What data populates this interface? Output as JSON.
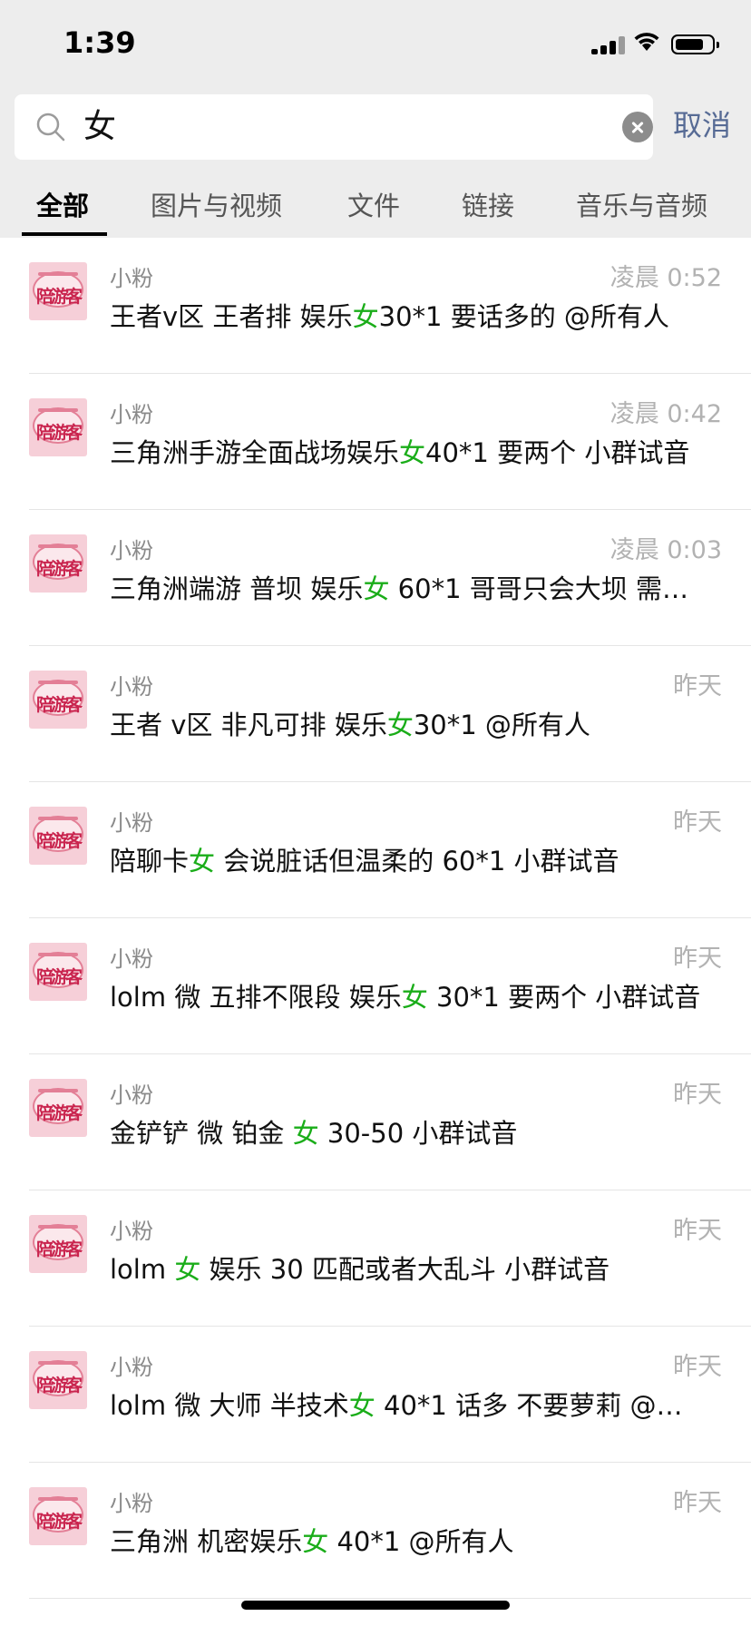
{
  "status_bar": {
    "time": "1:39",
    "battery_level": 0.8
  },
  "search": {
    "query": "女",
    "cancel_label": "取消"
  },
  "tabs": [
    {
      "label": "全部",
      "active": true
    },
    {
      "label": "图片与视频",
      "active": false
    },
    {
      "label": "文件",
      "active": false
    },
    {
      "label": "链接",
      "active": false
    },
    {
      "label": "音乐与音频",
      "active": false
    }
  ],
  "avatar_text": "陪游客",
  "highlight_color": "#1aad19",
  "results": [
    {
      "sender": "小粉",
      "time": "凌晨 0:52",
      "pre": "王者v区 王者排  娱乐",
      "hit": "女",
      "post": "30*1  要话多的  @所有人"
    },
    {
      "sender": "小粉",
      "time": "凌晨 0:42",
      "pre": "三角洲手游全面战场娱乐",
      "hit": "女",
      "post": "40*1 要两个 小群试音"
    },
    {
      "sender": "小粉",
      "time": "凌晨 0:03",
      "pre": "三角洲端游 普坝 娱乐",
      "hit": "女",
      "post": " 60*1 哥哥只会大坝 需…"
    },
    {
      "sender": "小粉",
      "time": "昨天",
      "pre": "王者  v区 非凡可排  娱乐",
      "hit": "女",
      "post": "30*1   @所有人"
    },
    {
      "sender": "小粉",
      "time": "昨天",
      "pre": "陪聊卡",
      "hit": "女",
      "post": " 会说脏话但温柔的 60*1 小群试音"
    },
    {
      "sender": "小粉",
      "time": "昨天",
      "pre": "lolm 微 五排不限段 娱乐",
      "hit": "女",
      "post": " 30*1 要两个 小群试音"
    },
    {
      "sender": "小粉",
      "time": "昨天",
      "pre": "金铲铲 微 铂金 ",
      "hit": "女",
      "post": " 30-50 小群试音"
    },
    {
      "sender": "小粉",
      "time": "昨天",
      "pre": "lolm ",
      "hit": "女",
      "post": " 娱乐 30 匹配或者大乱斗 小群试音"
    },
    {
      "sender": "小粉",
      "time": "昨天",
      "pre": "lolm 微 大师 半技术",
      "hit": "女",
      "post": " 40*1  话多 不要萝莉  @…"
    },
    {
      "sender": "小粉",
      "time": "昨天",
      "pre": "三角洲 机密娱乐",
      "hit": "女",
      "post": " 40*1 @所有人"
    }
  ]
}
